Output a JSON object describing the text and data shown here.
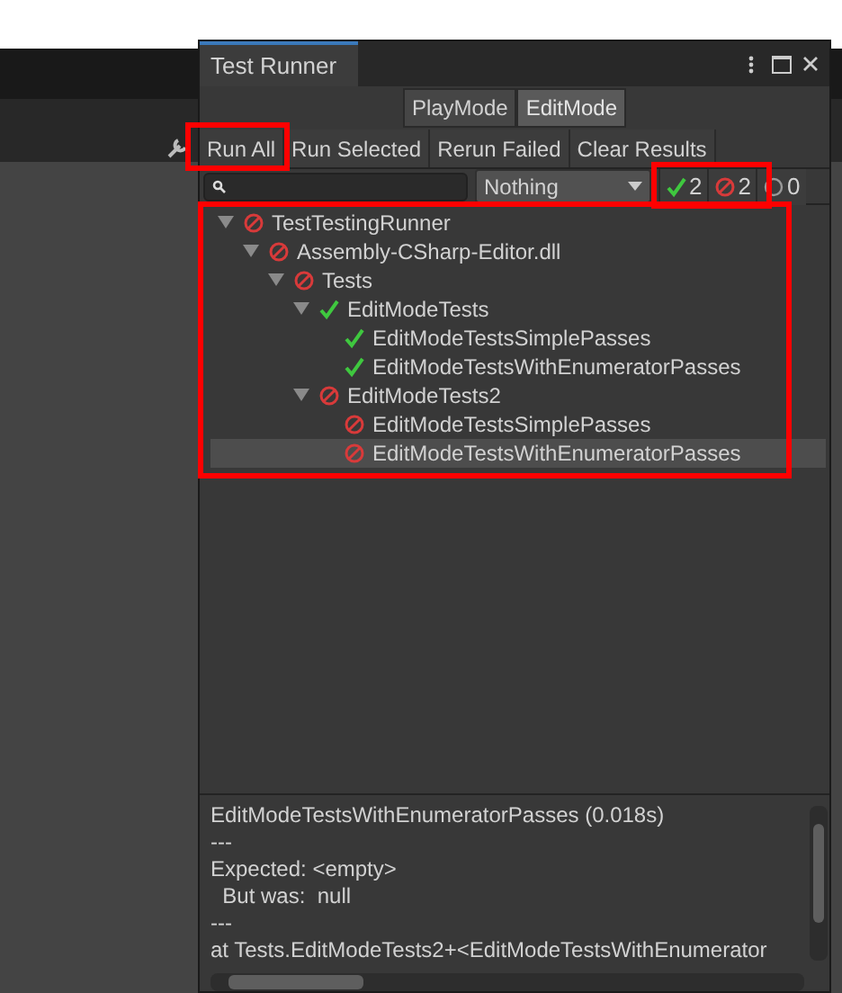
{
  "window": {
    "title": "Test Runner"
  },
  "mode_tabs": [
    {
      "label": "PlayMode",
      "selected": false
    },
    {
      "label": "EditMode",
      "selected": true
    }
  ],
  "toolbar": [
    "Run All",
    "Run Selected",
    "Rerun Failed",
    "Clear Results"
  ],
  "filter": {
    "dropdown": "Nothing",
    "counters": [
      {
        "kind": "passed",
        "count": "2"
      },
      {
        "kind": "failed",
        "count": "2"
      },
      {
        "kind": "skipped",
        "count": "0"
      }
    ]
  },
  "tree": [
    {
      "label": "TestTestingRunner",
      "kind": "failed",
      "expanded": true,
      "selected": false,
      "children": [
        {
          "label": "Assembly-CSharp-Editor.dll",
          "kind": "failed",
          "expanded": true,
          "selected": false,
          "children": [
            {
              "label": "Tests",
              "kind": "failed",
              "expanded": true,
              "selected": false,
              "children": [
                {
                  "label": "EditModeTests",
                  "kind": "passed",
                  "expanded": true,
                  "selected": false,
                  "children": [
                    {
                      "label": "EditModeTestsSimplePasses",
                      "kind": "passed",
                      "selected": false
                    },
                    {
                      "label": "EditModeTestsWithEnumeratorPasses",
                      "kind": "passed",
                      "selected": false
                    }
                  ]
                },
                {
                  "label": "EditModeTests2",
                  "kind": "failed",
                  "expanded": true,
                  "selected": false,
                  "children": [
                    {
                      "label": "EditModeTestsSimplePasses",
                      "kind": "failed",
                      "selected": false
                    },
                    {
                      "label": "EditModeTestsWithEnumeratorPasses",
                      "kind": "failed",
                      "selected": true
                    }
                  ]
                }
              ]
            }
          ]
        }
      ]
    }
  ],
  "details": [
    "EditModeTestsWithEnumeratorPasses (0.018s)",
    "---",
    "Expected: <empty>",
    "  But was:  null",
    "---",
    "at Tests.EditModeTests2+<EditModeTestsWithEnumerator"
  ]
}
